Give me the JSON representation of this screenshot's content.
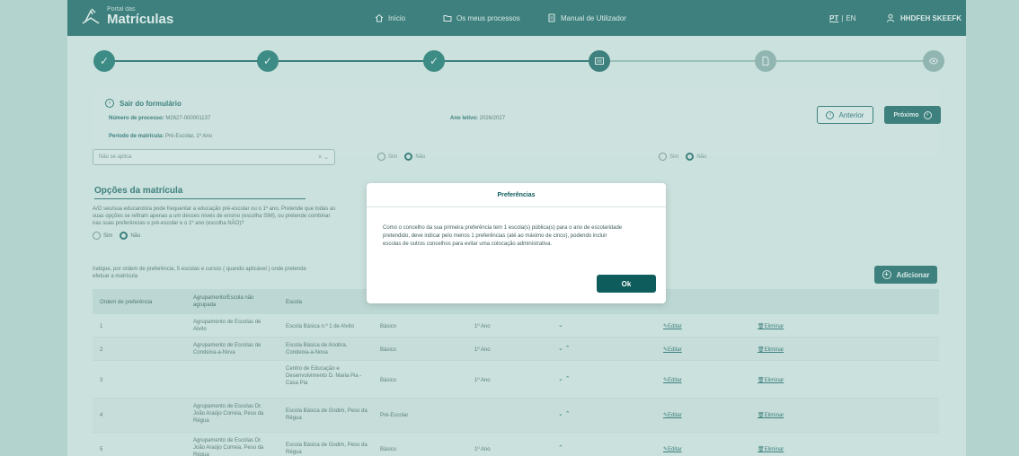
{
  "header": {
    "logo_small": "Portal das",
    "logo_big": "Matrículas",
    "nav": [
      "Início",
      "Os meus processos",
      "Manual de Utilizador"
    ],
    "lang_pt": "PT",
    "lang_sep": "|",
    "lang_en": "EN",
    "user": "HHDFEH SKEEFK"
  },
  "stepper": {
    "states": [
      "done",
      "done",
      "done",
      "current",
      "pending",
      "pending"
    ]
  },
  "form": {
    "exit_label": "Sair do formulário",
    "process_label": "Número de processo:",
    "process_value": "M2627-000001137",
    "year_label": "Ano letivo:",
    "year_value": "2026/2027",
    "period_label": "Período de matrícula:",
    "period_value": "Pré-Escolar, 1º Ano",
    "prev_button": "Anterior",
    "next_button": "Próximo",
    "select_value": "Não se aplica",
    "radio_yes": "Sim",
    "radio_no": "Não"
  },
  "options": {
    "title": "Opções da matrícula",
    "question_l1": "A/O seu/sua educando/a pode frequentar a educação pré-escolar ou o 1º ano. Pretende que todas as",
    "question_l2": "suas opções se refiram apenas a um desses níveis de ensino (escolha SIM), ou pretende combinar",
    "question_l3": "nas suas preferências o pré-escolar e o 1º ano (escolha NÃO)?",
    "yes": "Sim",
    "no": "Não",
    "instr_l1": "Indique, por ordem de preferência, 5 escolas e cursos ( quando aplicável ) onde pretende",
    "instr_l2": "efetuar a matrícula",
    "add_button": "Adicionar"
  },
  "table": {
    "headers": [
      "Ordem de preferência",
      "Agrupamento/Escola não agrupada",
      "Escola"
    ],
    "rows": [
      {
        "order": "1",
        "group": "Agrupamento de Escolas de Alvito",
        "school": "Escola Básica n.º 1 de Alvito",
        "level": "Básico",
        "year": "1º Ano",
        "arrows": "⌄",
        "edit": "Editar",
        "delete": "Eliminar"
      },
      {
        "order": "2",
        "group": "Agrupamento de Escolas de Condeixa-a-Nova",
        "school": "Escola Básica de Anobra, Condeixa-a-Nova",
        "level": "Básico",
        "year": "1º Ano",
        "arrows": "⌄ ⌃",
        "edit": "Editar",
        "delete": "Eliminar"
      },
      {
        "order": "3",
        "group": "",
        "school": "Centro de Educação e Desenvolvimento D. Maria Pia - Casa Pia",
        "level": "Básico",
        "year": "1º Ano",
        "arrows": "⌄ ⌃",
        "edit": "Editar",
        "delete": "Eliminar"
      },
      {
        "order": "4",
        "group": "Agrupamento de Escolas Dr. João Araújo Correia, Peso da Régua",
        "school": "Escola Básica de Godim, Peso da Régua",
        "level": "Pré-Escolar",
        "year": "",
        "arrows": "⌄ ⌃",
        "edit": "Editar",
        "delete": "Eliminar"
      },
      {
        "order": "5",
        "group": "Agrupamento de Escolas Dr. João Araújo Correia, Peso da Régua",
        "school": "Escola Básica de Godim, Peso da Régua",
        "level": "Básico",
        "year": "1º Ano",
        "arrows": "⌃",
        "edit": "Editar",
        "delete": "Eliminar"
      }
    ]
  },
  "modal": {
    "title": "Preferências",
    "text_l1": "Como o concelho da sua primeira preferência tem 1 escola(s) pública(s) para o ano de escolaridade",
    "text_l2": "pretendido, deve indicar pelo menos 1 preferências (até ao máximo de cinco), podendo incluir",
    "text_l3": "escolas de outros concelhos para evitar uma colocação administrativa.",
    "ok": "Ok"
  },
  "colors": {
    "primary": "#0e5c5b",
    "overlay": "#96c4be"
  }
}
